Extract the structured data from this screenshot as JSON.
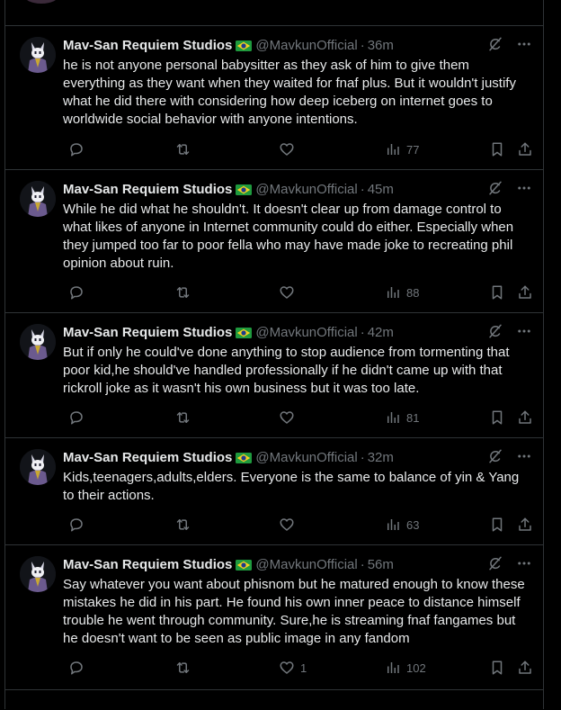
{
  "tweets": [
    {
      "author": "Mav-San Requiem Studios",
      "handle": "@MavkunOfficial",
      "time": "36m",
      "text": "he is not anyone personal babysitter as they ask of him to give them everything as they want when they waited for fnaf plus. But it wouldn't justify what he did there with considering how deep iceberg on internet goes to worldwide social behavior with anyone intentions.",
      "replies": "",
      "reposts": "",
      "likes": "",
      "views": "77"
    },
    {
      "author": "Mav-San Requiem Studios",
      "handle": "@MavkunOfficial",
      "time": "45m",
      "text": "While he did what he shouldn't. It doesn't clear up from damage control to what likes of anyone in Internet community could do either. Especially when they jumped too far to poor fella who may have made joke to recreating phil opinion about ruin.",
      "replies": "",
      "reposts": "",
      "likes": "",
      "views": "88"
    },
    {
      "author": "Mav-San Requiem Studios",
      "handle": "@MavkunOfficial",
      "time": "42m",
      "text": "But if only he could've done anything to stop audience from tormenting that poor kid,he should've handled professionally if he didn't came up with that rickroll joke as it wasn't his own business but it was too late.",
      "replies": "",
      "reposts": "",
      "likes": "",
      "views": "81"
    },
    {
      "author": "Mav-San Requiem Studios",
      "handle": "@MavkunOfficial",
      "time": "32m",
      "text": "Kids,teenagers,adults,elders. Everyone is the same to balance of yin & Yang to their actions.",
      "replies": "",
      "reposts": "",
      "likes": "",
      "views": "63"
    },
    {
      "author": "Mav-San Requiem Studios",
      "handle": "@MavkunOfficial",
      "time": "56m",
      "text": "Say whatever you want about phisnom but he matured enough to know these mistakes he did in his part. He found his own inner peace to distance himself trouble he went through community. Sure,he is streaming fnaf fangames but he doesn't want to be seen as public image in any fandom",
      "replies": "",
      "reposts": "",
      "likes": "1",
      "views": "102"
    }
  ],
  "icons": {
    "flag": "brazil-flag-icon",
    "grok": "grok-icon",
    "more": "more-icon",
    "reply": "reply-icon",
    "repost": "repost-icon",
    "like": "heart-icon",
    "views": "views-icon",
    "bookmark": "bookmark-icon",
    "share": "share-icon"
  },
  "colors": {
    "background": "#000000",
    "text": "#e7e9ea",
    "muted": "#71767b",
    "border": "#2f3336"
  }
}
